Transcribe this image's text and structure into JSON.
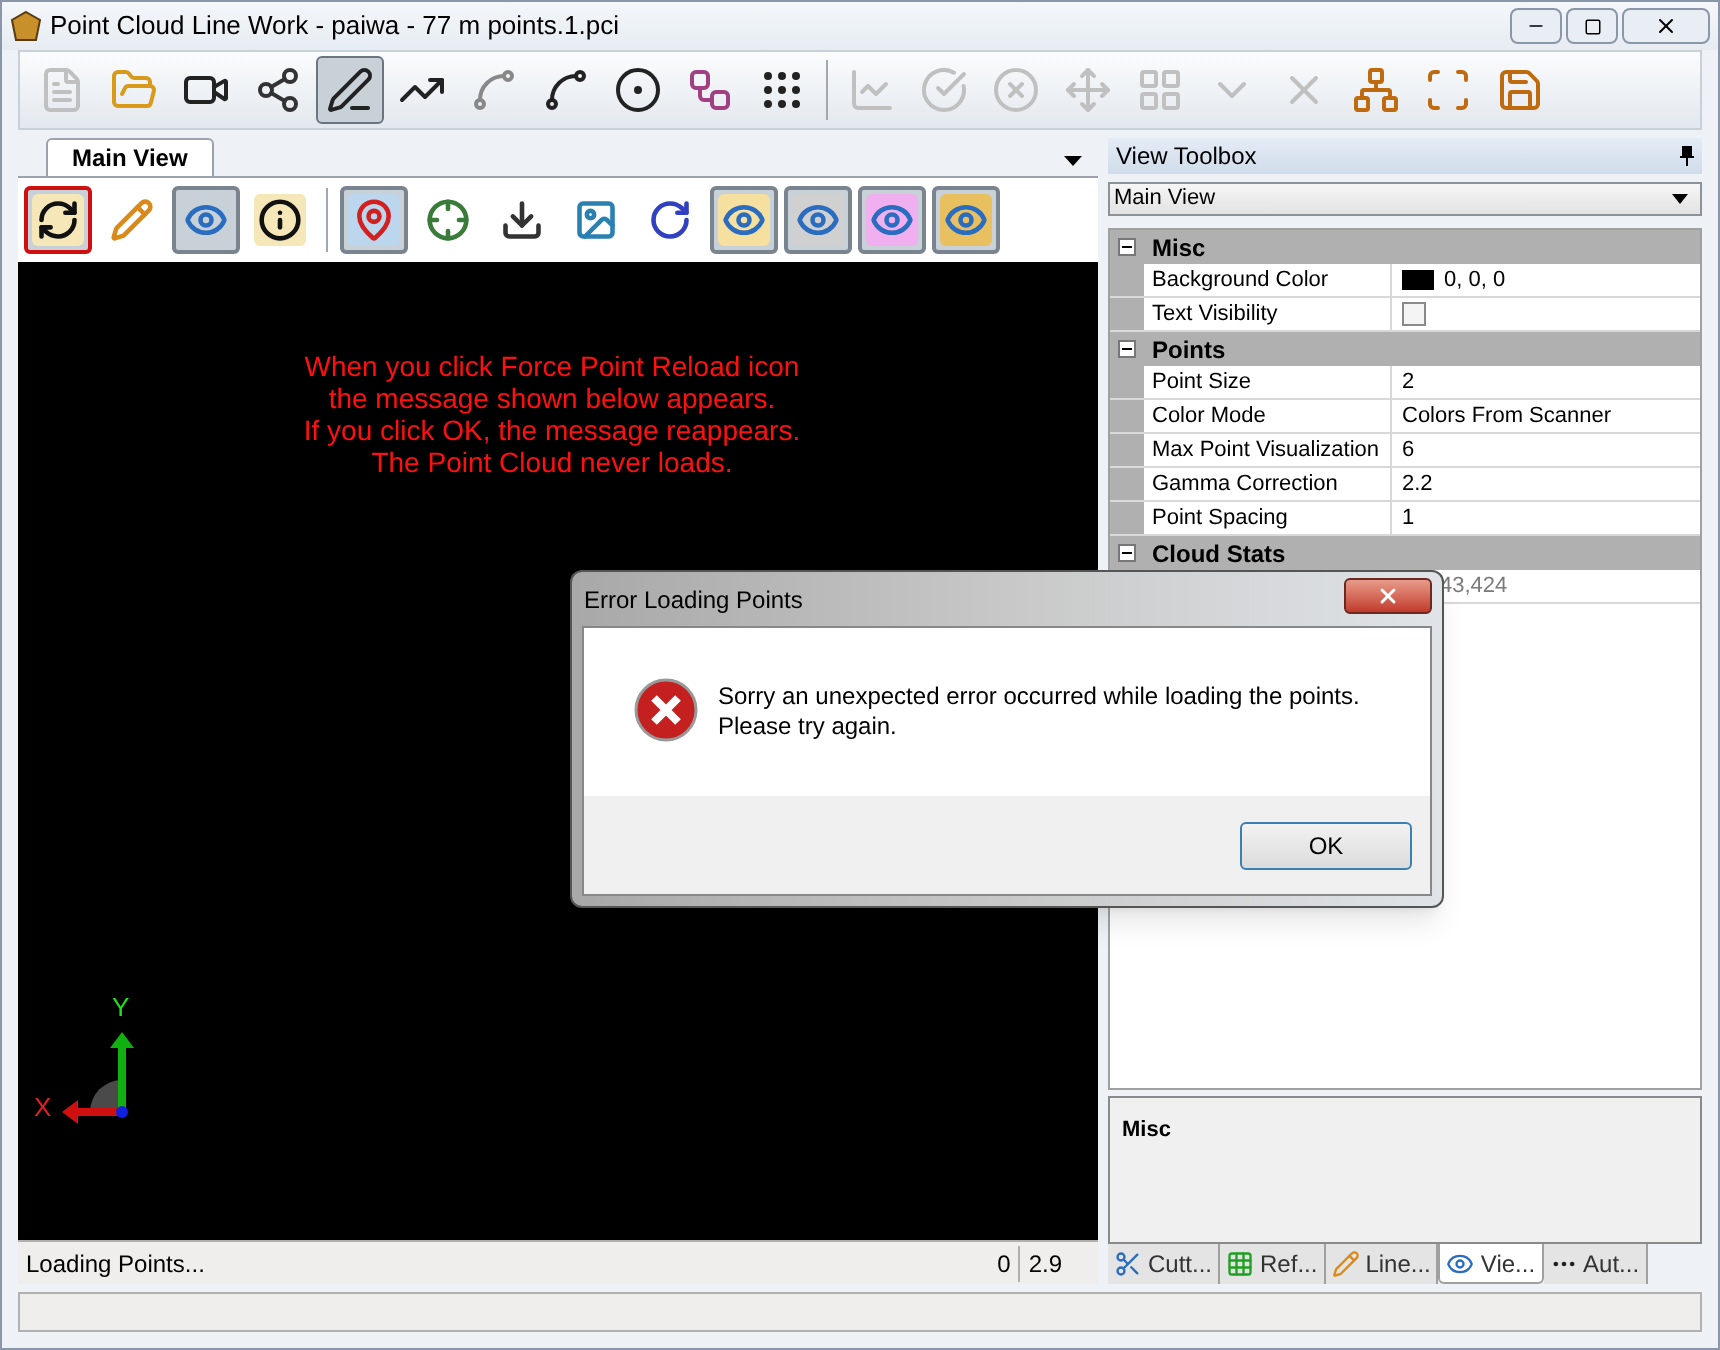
{
  "window": {
    "title": "Point Cloud Line Work - paiwa - 77 m points.1.pci"
  },
  "toolbar": {
    "groups": [
      [
        {
          "kind": "document",
          "disabled": true,
          "selected": false
        },
        {
          "kind": "folder",
          "disabled": false,
          "selected": false
        },
        {
          "kind": "camera",
          "disabled": false,
          "selected": false
        },
        {
          "kind": "graph",
          "disabled": false,
          "selected": false
        },
        {
          "kind": "line",
          "disabled": false,
          "selected": true
        },
        {
          "kind": "polyline",
          "disabled": false,
          "selected": false
        },
        {
          "kind": "spline",
          "disabled": false,
          "selected": false
        },
        {
          "kind": "arc",
          "disabled": false,
          "selected": false
        },
        {
          "kind": "circle",
          "disabled": false,
          "selected": false
        },
        {
          "kind": "points",
          "disabled": false,
          "selected": false
        },
        {
          "kind": "dotted",
          "disabled": false,
          "selected": false
        }
      ],
      [
        {
          "kind": "curve",
          "disabled": true,
          "selected": false
        },
        {
          "kind": "check",
          "disabled": true,
          "selected": false
        },
        {
          "kind": "remove",
          "disabled": true,
          "selected": false
        },
        {
          "kind": "move",
          "disabled": true,
          "selected": false
        },
        {
          "kind": "grid",
          "disabled": true,
          "selected": false
        },
        {
          "kind": "chevron",
          "disabled": true,
          "selected": false
        },
        {
          "kind": "cross",
          "disabled": true,
          "selected": false
        },
        {
          "kind": "network",
          "disabled": false,
          "selected": false
        },
        {
          "kind": "select",
          "disabled": false,
          "selected": false
        },
        {
          "kind": "save",
          "disabled": false,
          "selected": false
        }
      ]
    ]
  },
  "main_view": {
    "tab": {
      "label": "Main View",
      "selected": true
    },
    "toolbar_groups": [
      [
        {
          "kind": "reload",
          "selected": true,
          "highlighted": true
        },
        {
          "kind": "pencil",
          "selected": false,
          "highlighted": false
        },
        {
          "kind": "eye",
          "selected": true,
          "highlighted": false
        },
        {
          "kind": "info",
          "selected": false,
          "highlighted": false
        }
      ],
      [
        {
          "kind": "pin",
          "selected": true,
          "highlighted": false
        },
        {
          "kind": "axes",
          "selected": false,
          "highlighted": false
        },
        {
          "kind": "import",
          "selected": false,
          "highlighted": false
        },
        {
          "kind": "image",
          "selected": false,
          "highlighted": false
        },
        {
          "kind": "rotate",
          "selected": false,
          "highlighted": false
        },
        {
          "kind": "eye-points",
          "selected": true,
          "highlighted": false
        },
        {
          "kind": "eye-lines",
          "selected": true,
          "highlighted": false
        },
        {
          "kind": "eye-mesh",
          "selected": true,
          "highlighted": false
        },
        {
          "kind": "eye-surface",
          "selected": true,
          "highlighted": false
        }
      ]
    ],
    "annotation": [
      "When you click Force Point Reload icon",
      "the message shown below appears.",
      "If you click OK, the message reappears.",
      "The Point Cloud never loads."
    ],
    "axes": {
      "x": "X",
      "y": "Y"
    },
    "status": {
      "message": "Loading Points...",
      "field_1": "0",
      "field_2": "2.9"
    }
  },
  "view_toolbox": {
    "title": "View Toolbox",
    "dropdown": "Main View",
    "categories": [
      {
        "name": "Misc",
        "expanded": true,
        "rows": [
          {
            "kind": "color",
            "name": "Background Color",
            "value": "0, 0, 0",
            "color": "#000000"
          },
          {
            "kind": "checkbox",
            "name": "Text Visibility",
            "checked": false
          }
        ]
      },
      {
        "name": "Points",
        "expanded": true,
        "rows": [
          {
            "kind": "text",
            "name": "Point Size",
            "value": "2"
          },
          {
            "kind": "text",
            "name": "Color Mode",
            "value": "Colors From Scanner"
          },
          {
            "kind": "text",
            "name": "Max Point Visualization",
            "value": "6"
          },
          {
            "kind": "text",
            "name": "Gamma Correction",
            "value": "2.2"
          },
          {
            "kind": "text",
            "name": "Point Spacing",
            "value": "1"
          }
        ]
      },
      {
        "name": "Cloud Stats",
        "expanded": true,
        "rows": [
          {
            "kind": "partial",
            "value": "43,424"
          }
        ]
      }
    ],
    "description": {
      "title": "Misc"
    },
    "tabs": [
      {
        "label": "Cutt...",
        "kind": "scissors",
        "selected": false
      },
      {
        "label": "Ref...",
        "kind": "grid",
        "selected": false
      },
      {
        "label": "Line...",
        "kind": "pencil",
        "selected": false
      },
      {
        "label": "Vie...",
        "kind": "eye",
        "selected": true
      },
      {
        "label": "Aut...",
        "kind": "dots",
        "selected": false
      }
    ]
  },
  "dialog": {
    "title": "Error Loading Points",
    "message": [
      "Sorry an unexpected error occurred while loading the points.",
      "Please try again."
    ],
    "button": "OK"
  }
}
